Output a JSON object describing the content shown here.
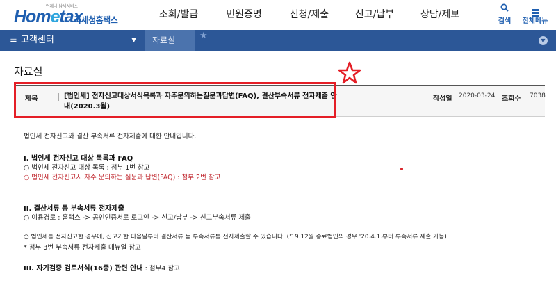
{
  "header": {
    "tagline": "언제나 납세서비스",
    "logo_prefix": "Hom",
    "logo_e": "e",
    "logo_suffix": "tax",
    "logo_sub": "국세청홈택스",
    "gnb": [
      "조회/발급",
      "민원증명",
      "신청/제출",
      "신고/납부",
      "상담/제보"
    ],
    "search_label": "검색",
    "allmenu_label": "전체메뉴"
  },
  "navbar": {
    "section": "고객센터",
    "current": "자료실"
  },
  "page": {
    "title": "자료실"
  },
  "article": {
    "subject_label": "제목",
    "subject": "[법인세] 전자신고대상서식목록과 자주문의하는질문과답변(FAQ), 결산부속서류 전자제출 안내(2020.3월)",
    "date_label": "작성일",
    "date": "2020-03-24",
    "views_label": "조회수",
    "views": "7038"
  },
  "body": {
    "intro": "법인세 전자신고와 결산 부속서류 전자제출에 대한 안내입니다.",
    "s1_title": "I. 법인세 전자신고 대상 목록과 FAQ",
    "s1_l1": "○ 법인세 전자신고 대상 목록 : 첨부 1번 참고",
    "s1_l2": "○ 법인세 전자신고시 자주 문의하는 질문과 답변(FAQ) : 첨부 2번 참고",
    "s2_title": "II. 결산서류 등 부속서류 전자제출",
    "s2_l1": "○ 이용경로 : 홈택스 -> 공인인증서로 로그인 -> 신고/납부 -> 신고부속서류 제출",
    "s2_l2": "○ 법인세를 전자신고한 경우에, 신고기한 다음날부터 결산서류 등 부속서류를 전자제출할 수 있습니다. ('19.12월 종료법인의 경우 '20.4.1.부터 부속서류 제출 가능)",
    "s2_l3": "* 첨부 3번 부속서류 전자제출 매뉴얼 참고",
    "s3_title": "III. 자기검증 검토서식(16종) 관련 안내",
    "s3_rest": " : 첨부4 참고"
  }
}
